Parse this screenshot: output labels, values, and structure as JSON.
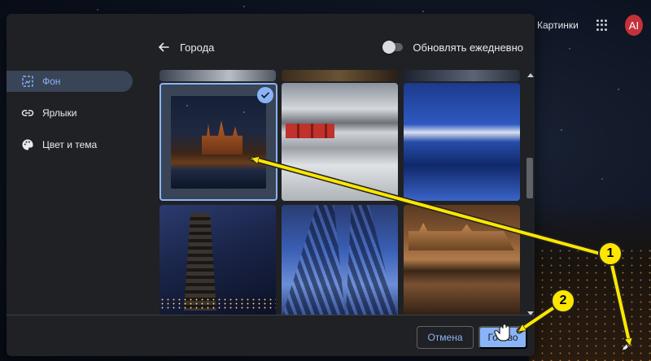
{
  "topbar": {
    "images_link": "Картинки",
    "avatar_initials": "AI"
  },
  "dialog": {
    "header": {
      "title": "Города",
      "toggle_label": "Обновлять ежедневно"
    },
    "sidebar": {
      "items": [
        {
          "label": "Фон",
          "icon": "background-icon",
          "active": true
        },
        {
          "label": "Ярлыки",
          "icon": "link-icon",
          "active": false
        },
        {
          "label": "Цвет и тема",
          "icon": "palette-icon",
          "active": false
        }
      ]
    },
    "footer": {
      "cancel_label": "Отмена",
      "done_label": "Готово"
    }
  },
  "annotations": {
    "badge_1": "1",
    "badge_2": "2",
    "color": "#ffe600"
  },
  "colors": {
    "accent": "#8ab4f8",
    "dialog_bg": "#202124"
  }
}
